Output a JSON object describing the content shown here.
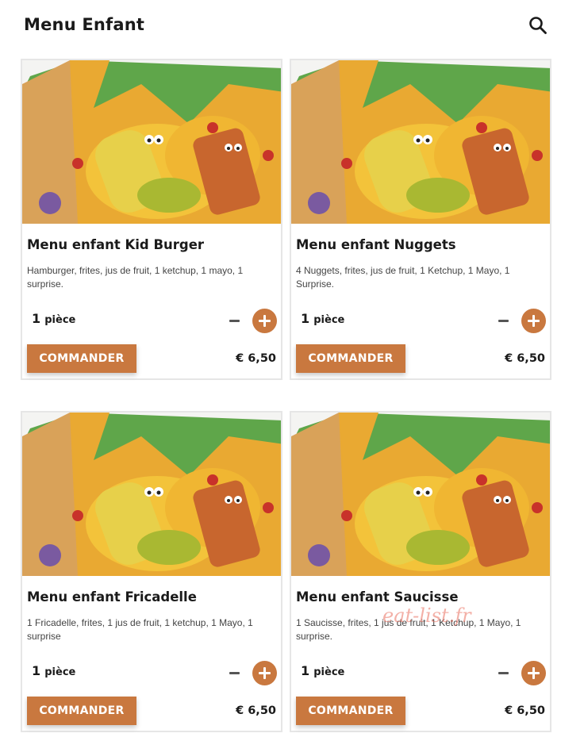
{
  "header": {
    "title": "Menu Enfant",
    "search_icon": "search-icon"
  },
  "colors": {
    "accent": "#c9783f",
    "card_border": "#e6e6e6",
    "text": "#1a1a1a"
  },
  "items": [
    {
      "title": "Menu enfant Kid Burger",
      "description": "Hamburger, frites, jus de fruit, 1 ketchup, 1 mayo, 1 surprise.",
      "quantity": "1",
      "unit": "pièce",
      "order_label": "COMMANDER",
      "price": "€ 6,50"
    },
    {
      "title": "Menu enfant Nuggets",
      "description": "4 Nuggets, frites, jus de fruit, 1 Ketchup, 1 Mayo, 1 Surprise.",
      "quantity": "1",
      "unit": "pièce",
      "order_label": "COMMANDER",
      "price": "€ 6,50"
    },
    {
      "title": "Menu enfant Fricadelle",
      "description": "1 Fricadelle, frites, 1 jus de fruit, 1 ketchup, 1 Mayo, 1 surprise",
      "quantity": "1",
      "unit": "pièce",
      "order_label": "COMMANDER",
      "price": "€ 6,50"
    },
    {
      "title": "Menu enfant Saucisse",
      "description": "1 Saucisse, frites, 1 jus de fruit, 1 Ketchup, 1 Mayo, 1 surprise.",
      "quantity": "1",
      "unit": "pièce",
      "order_label": "COMMANDER",
      "price": "€ 6,50"
    }
  ],
  "watermark": "eat-list.fr"
}
